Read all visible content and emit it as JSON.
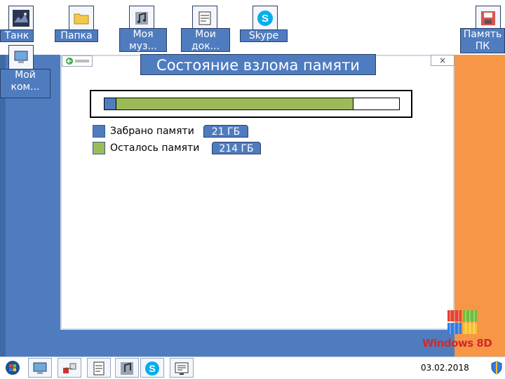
{
  "desktop": {
    "icons": [
      {
        "label": "Танк"
      },
      {
        "label": "Папка"
      },
      {
        "label": "Моя муз..."
      },
      {
        "label": "Мои док..."
      },
      {
        "label": "Skype"
      },
      {
        "label": "Память ПК"
      },
      {
        "label": "Мой ком..."
      }
    ]
  },
  "window": {
    "title": "Состояние взлома памяти",
    "close_label": "×",
    "progress": {
      "taken_fraction": 0.0415,
      "remaining_fraction": 0.8037,
      "colors": {
        "taken": "#4f7cbf",
        "remaining": "#9bbb59"
      }
    },
    "legend": [
      {
        "label": "Забрано памяти",
        "value": "21 ГБ",
        "color": "#4f7cbf"
      },
      {
        "label": "Осталось памяти",
        "value": "214 ГБ",
        "color": "#9bbb59"
      }
    ]
  },
  "logo": {
    "text": "Windows 8D"
  },
  "taskbar": {
    "buttons": [
      "start-orb-icon",
      "computer-icon",
      "network-icon",
      "documents-icon",
      "music-icon",
      "skype-icon",
      "memory-icon"
    ],
    "clock": "03.02.2018"
  }
}
